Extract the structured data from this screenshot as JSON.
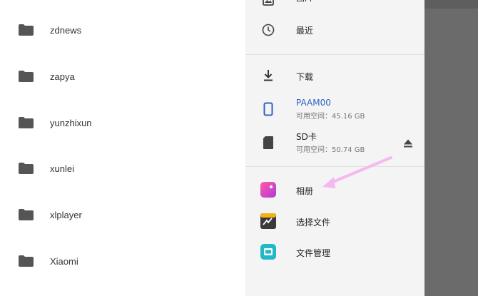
{
  "folders": [
    {
      "name": "zdnews"
    },
    {
      "name": "zapya"
    },
    {
      "name": "yunzhixun"
    },
    {
      "name": "xunlei"
    },
    {
      "name": "xlplayer"
    },
    {
      "name": "Xiaomi"
    }
  ],
  "drawer": {
    "images_label": "图片",
    "recent_label": "最近",
    "downloads_label": "下载",
    "device": {
      "name": "PAAM00",
      "space": "可用空间：45.16 GB"
    },
    "sdcard": {
      "name": "SD卡",
      "space": "可用空间：50.74 GB"
    },
    "apps": [
      {
        "label": "相册"
      },
      {
        "label": "选择文件"
      },
      {
        "label": "文件管理"
      }
    ]
  },
  "colors": {
    "accent_blue": "#2d63c8",
    "annotation_pink": "#f5b8f0",
    "scrim": "#6b6b6b"
  }
}
